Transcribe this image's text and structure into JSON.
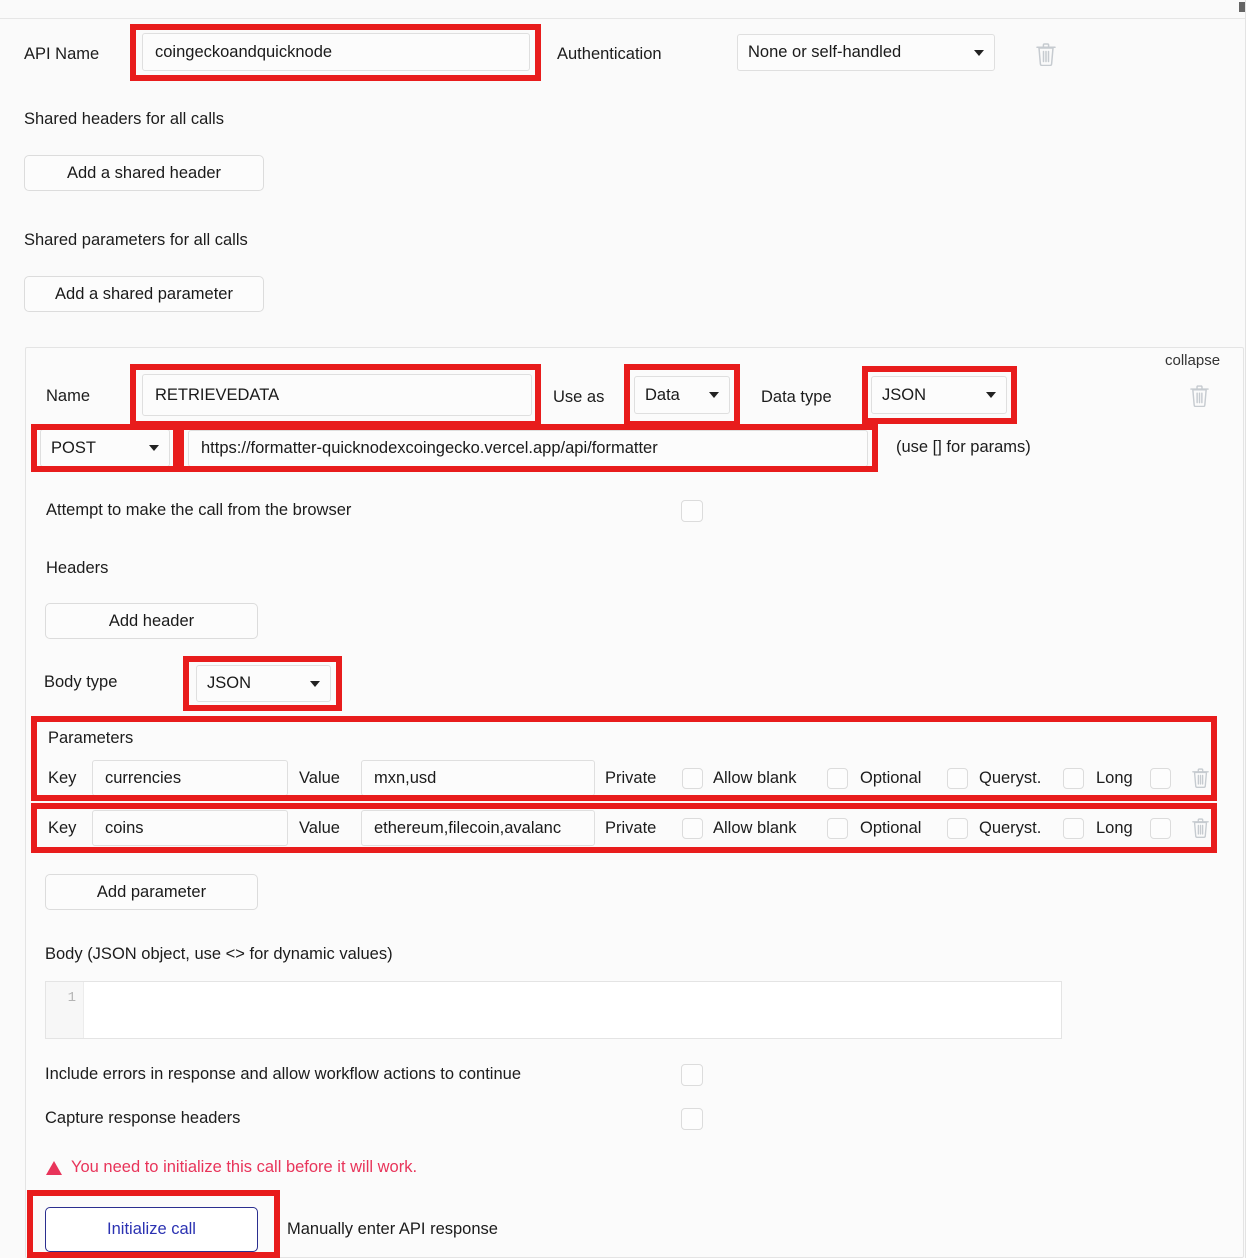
{
  "api": {
    "name_label": "API Name",
    "name_value": "coingeckoandquicknode",
    "auth_label": "Authentication",
    "auth_value": "None or self-handled",
    "delete_icon": "trash-icon"
  },
  "shared": {
    "headers_label": "Shared headers for all calls",
    "add_header_button": "Add a shared header",
    "params_label": "Shared parameters for all calls",
    "add_param_button": "Add a shared parameter"
  },
  "call": {
    "collapse_label": "collapse",
    "delete_icon": "trash-icon",
    "name_label": "Name",
    "name_value": "RETRIEVEDATA",
    "use_as_label": "Use as",
    "use_as_value": "Data",
    "data_type_label": "Data type",
    "data_type_value": "JSON",
    "method_value": "POST",
    "url_value": "https://formatter-quicknodexcoingecko.vercel.app/api/formatter",
    "url_hint": "(use [] for params)",
    "browser_call_label": "Attempt to make the call from the browser",
    "browser_call_checked": false,
    "headers_label": "Headers",
    "add_header_button": "Add header",
    "body_type_label": "Body type",
    "body_type_value": "JSON",
    "parameters_label": "Parameters",
    "add_parameter_button": "Add parameter",
    "body_label": "Body (JSON object, use <> for dynamic values)",
    "body_line_number": "1",
    "body_value": "",
    "include_errors_label": "Include errors in response and allow workflow actions to continue",
    "include_errors_checked": false,
    "capture_headers_label": "Capture response headers",
    "capture_headers_checked": false,
    "warning_text": "You need to initialize this call before it will work.",
    "initialize_button": "Initialize call",
    "manual_response_label": "Manually enter API response"
  },
  "param_columns": {
    "key_label": "Key",
    "value_label": "Value",
    "private_label": "Private",
    "allow_blank_label": "Allow blank",
    "optional_label": "Optional",
    "querystring_label": "Queryst.",
    "long_label": "Long",
    "delete_icon": "trash-icon"
  },
  "parameters": [
    {
      "key": "currencies",
      "value": "mxn,usd",
      "private": false,
      "allow_blank": false,
      "optional": false,
      "querystring": false,
      "long": false
    },
    {
      "key": "coins",
      "value": "ethereum,filecoin,avalanc",
      "private": false,
      "allow_blank": false,
      "optional": false,
      "querystring": false,
      "long": false
    }
  ],
  "colors": {
    "annotation": "#e81c1c",
    "warning": "#e8345a",
    "primary_button_text": "#2b32b2",
    "page_background": "#fafafa"
  }
}
